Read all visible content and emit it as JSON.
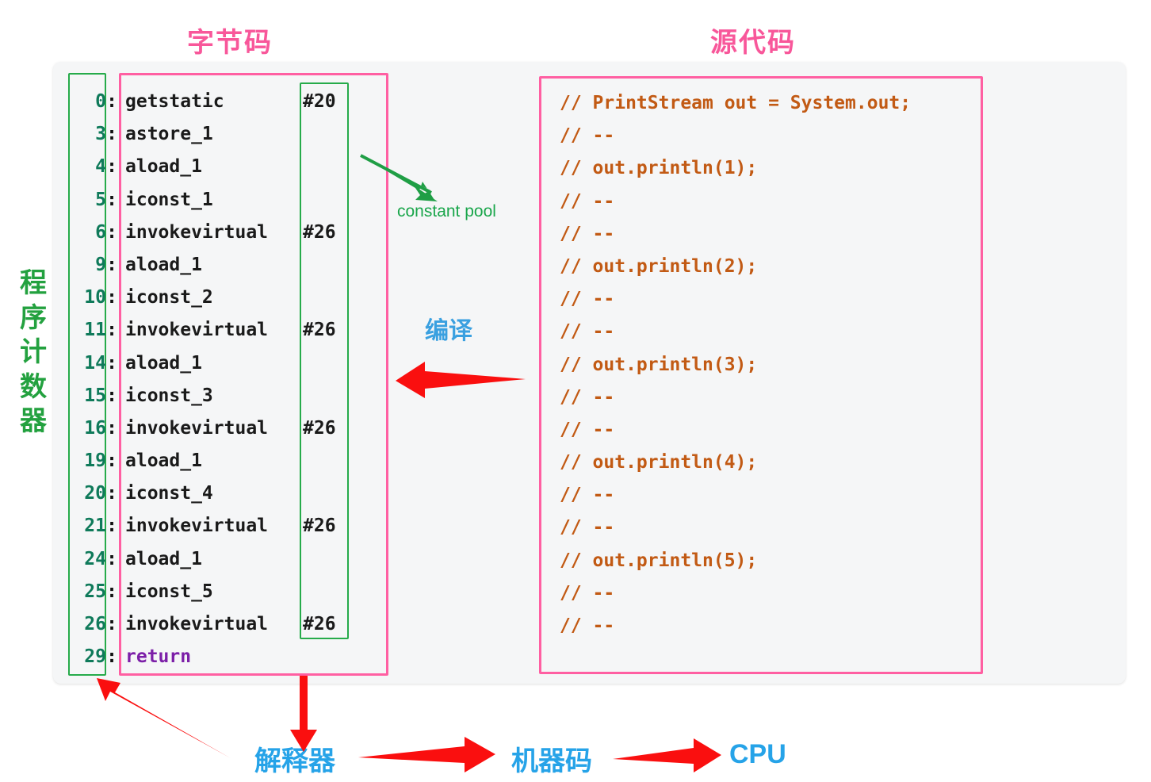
{
  "headings": {
    "bytecode": "字节码",
    "source": "源代码"
  },
  "program_counter": {
    "label_chars": [
      "程",
      "序",
      "计",
      "数",
      "器"
    ],
    "label": "程序计数器"
  },
  "annotations": {
    "constant_pool": "constant pool",
    "compile": "编译"
  },
  "bytecode": {
    "rows": [
      {
        "pc": "0",
        "colon": ":",
        "op": "getstatic",
        "ref": "#20",
        "keyword": false
      },
      {
        "pc": "3",
        "colon": ":",
        "op": "astore_1",
        "ref": "",
        "keyword": false
      },
      {
        "pc": "4",
        "colon": ":",
        "op": "aload_1",
        "ref": "",
        "keyword": false
      },
      {
        "pc": "5",
        "colon": ":",
        "op": "iconst_1",
        "ref": "",
        "keyword": false
      },
      {
        "pc": "6",
        "colon": ":",
        "op": "invokevirtual",
        "ref": "#26",
        "keyword": false
      },
      {
        "pc": "9",
        "colon": ":",
        "op": "aload_1",
        "ref": "",
        "keyword": false
      },
      {
        "pc": "10",
        "colon": ":",
        "op": "iconst_2",
        "ref": "",
        "keyword": false
      },
      {
        "pc": "11",
        "colon": ":",
        "op": "invokevirtual",
        "ref": "#26",
        "keyword": false
      },
      {
        "pc": "14",
        "colon": ":",
        "op": "aload_1",
        "ref": "",
        "keyword": false
      },
      {
        "pc": "15",
        "colon": ":",
        "op": "iconst_3",
        "ref": "",
        "keyword": false
      },
      {
        "pc": "16",
        "colon": ":",
        "op": "invokevirtual",
        "ref": "#26",
        "keyword": false
      },
      {
        "pc": "19",
        "colon": ":",
        "op": "aload_1",
        "ref": "",
        "keyword": false
      },
      {
        "pc": "20",
        "colon": ":",
        "op": "iconst_4",
        "ref": "",
        "keyword": false
      },
      {
        "pc": "21",
        "colon": ":",
        "op": "invokevirtual",
        "ref": "#26",
        "keyword": false
      },
      {
        "pc": "24",
        "colon": ":",
        "op": "aload_1",
        "ref": "",
        "keyword": false
      },
      {
        "pc": "25",
        "colon": ":",
        "op": "iconst_5",
        "ref": "",
        "keyword": false
      },
      {
        "pc": "26",
        "colon": ":",
        "op": "invokevirtual",
        "ref": "#26",
        "keyword": false
      },
      {
        "pc": "29",
        "colon": ":",
        "op": "return",
        "ref": "",
        "keyword": true
      }
    ]
  },
  "source": {
    "lines": [
      "// PrintStream out = System.out;",
      "// --",
      "// out.println(1);",
      "// --",
      "// --",
      "// out.println(2);",
      "// --",
      "// --",
      "// out.println(3);",
      "// --",
      "// --",
      "// out.println(4);",
      "// --",
      "// --",
      "// out.println(5);",
      "// --",
      "// --"
    ]
  },
  "flow": {
    "interpreter": "解释器",
    "machine_code": "机器码",
    "cpu": "CPU"
  },
  "colors": {
    "pink": "#ff5fa2",
    "heading_pink": "#f8579a",
    "green": "#26ab4a",
    "pc_green": "#23a13f",
    "red_arrow": "#fa0f0f",
    "blue": "#26a3e8",
    "source_brown": "#c25a14",
    "keyword_purple": "#7c1fa8",
    "card_bg": "#f5f6f7"
  }
}
